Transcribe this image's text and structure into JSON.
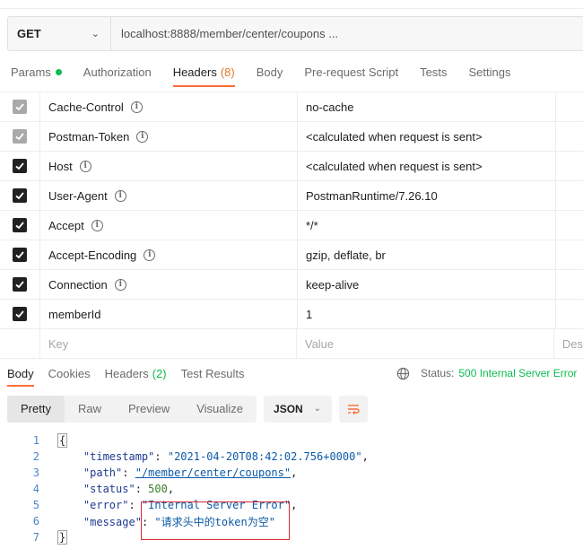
{
  "request": {
    "method": "GET",
    "url": "localhost:8888/member/center/coupons ..."
  },
  "request_tabs": [
    {
      "label": "Params",
      "indicator": "green-dot"
    },
    {
      "label": "Authorization"
    },
    {
      "label": "Headers",
      "count": "(8)",
      "active": true
    },
    {
      "label": "Body"
    },
    {
      "label": "Pre-request Script"
    },
    {
      "label": "Tests"
    },
    {
      "label": "Settings"
    }
  ],
  "headers": [
    {
      "key": "Cache-Control",
      "value": "no-cache",
      "checked": "gray"
    },
    {
      "key": "Postman-Token",
      "value": "<calculated when request is sent>",
      "checked": "gray"
    },
    {
      "key": "Host",
      "value": "<calculated when request is sent>",
      "checked": "on"
    },
    {
      "key": "User-Agent",
      "value": "PostmanRuntime/7.26.10",
      "checked": "on"
    },
    {
      "key": "Accept",
      "value": "*/*",
      "checked": "on"
    },
    {
      "key": "Accept-Encoding",
      "value": "gzip, deflate, br",
      "checked": "on"
    },
    {
      "key": "Connection",
      "value": "keep-alive",
      "checked": "on"
    },
    {
      "key": "memberId",
      "value": "1",
      "checked": "on"
    }
  ],
  "new_row": {
    "key_placeholder": "Key",
    "value_placeholder": "Value",
    "desc_placeholder": "Des"
  },
  "response_tabs": [
    {
      "label": "Body",
      "active": true
    },
    {
      "label": "Cookies"
    },
    {
      "label": "Headers",
      "count": "(2)"
    },
    {
      "label": "Test Results"
    }
  ],
  "status": {
    "label": "Status:",
    "code": "500 Internal Server Error"
  },
  "view_modes": [
    "Pretty",
    "Raw",
    "Preview",
    "Visualize"
  ],
  "format": "JSON",
  "response_body": {
    "line_numbers": [
      "1",
      "2",
      "3",
      "4",
      "5",
      "6",
      "7"
    ],
    "open_brace": "{",
    "close_brace": "}",
    "fields": [
      {
        "key": "\"timestamp\"",
        "value": "\"2021-04-20T08:42:02.756+0000\"",
        "type": "string",
        "comma": ","
      },
      {
        "key": "\"path\"",
        "value": "\"/member/center/coupons\"",
        "type": "link",
        "comma": ","
      },
      {
        "key": "\"status\"",
        "value": "500",
        "type": "number",
        "comma": ","
      },
      {
        "key": "\"error\"",
        "value": "\"Internal Server Error\"",
        "type": "string",
        "comma": ","
      },
      {
        "key": "\"message\"",
        "value": "\"请求头中的token为空\"",
        "type": "string",
        "comma": ""
      }
    ]
  },
  "colors": {
    "accent": "#ff6c37",
    "success": "#0cbb52",
    "annotation": "#d9282f"
  }
}
